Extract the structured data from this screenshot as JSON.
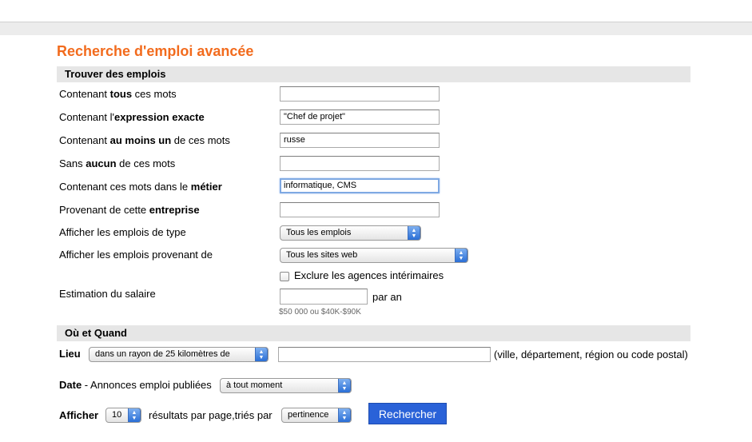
{
  "title": "Recherche d'emploi avancée",
  "section_find": "Trouver des emplois",
  "fields": {
    "all_words": {
      "pre": "Contenant ",
      "bold": "tous",
      "post": " ces mots",
      "value": ""
    },
    "exact": {
      "pre": "Contenant l'",
      "bold": "expression exacte",
      "post": "",
      "value": "\"Chef de projet\""
    },
    "at_least": {
      "pre": "Contenant ",
      "bold": "au moins un",
      "post": " de ces mots",
      "value": "russe"
    },
    "without": {
      "pre": "Sans ",
      "bold": "aucun",
      "post": " de ces mots",
      "value": ""
    },
    "title_words": {
      "pre": "Contenant ces mots dans le ",
      "bold": "métier",
      "post": "",
      "value": "informatique, CMS"
    },
    "company": {
      "pre": "Provenant de cette ",
      "bold": "entreprise",
      "post": "",
      "value": ""
    }
  },
  "job_type": {
    "label": "Afficher les emplois de type",
    "selected": "Tous les emplois"
  },
  "source": {
    "label": "Afficher les emplois provenant de",
    "selected": "Tous les sites web"
  },
  "exclude_agencies": {
    "label": "Exclure les agences intérimaires",
    "checked": false
  },
  "salary": {
    "label": "Estimation du salaire",
    "value": "",
    "suffix": "par an",
    "hint": "$50 000 ou $40K-$90K"
  },
  "section_where": "Où et Quand",
  "location": {
    "label": "Lieu",
    "radius_selected": "dans un rayon de 25 kilomètres de",
    "value": "",
    "hint": "(ville, département, région ou code postal)"
  },
  "date": {
    "label_bold": "Date",
    "label_rest": " - Annonces emploi publiées",
    "selected": "à tout moment"
  },
  "display": {
    "label": "Afficher",
    "per_page": "10",
    "middle": "résultats par page,triés par",
    "sort": "pertinence"
  },
  "search_button": "Rechercher",
  "colors": {
    "accent": "#f26b1d",
    "button": "#2a62d8"
  }
}
